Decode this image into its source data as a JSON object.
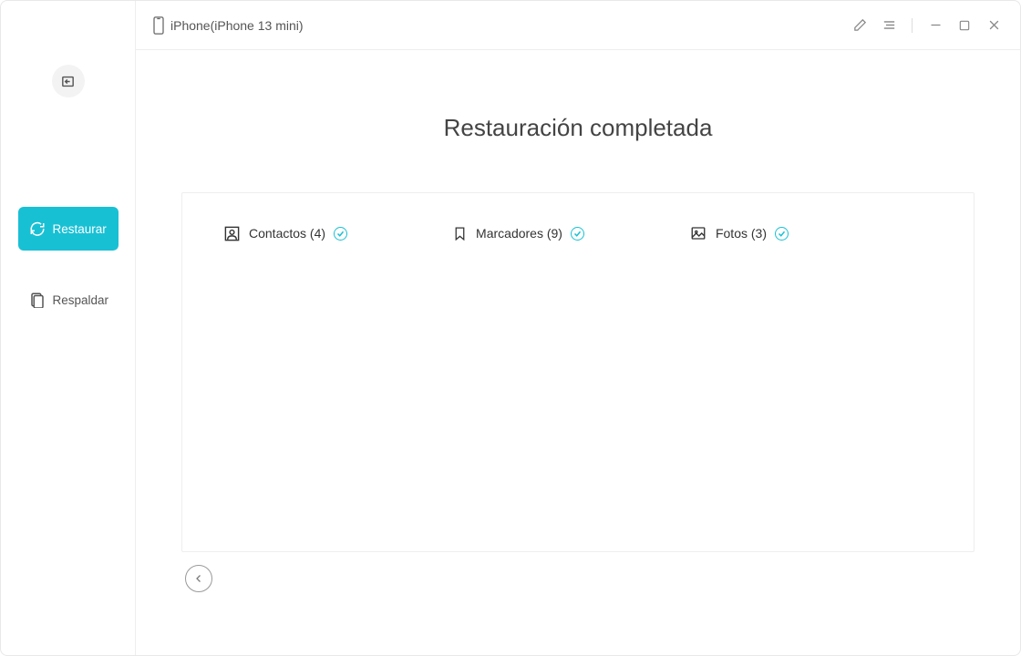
{
  "header": {
    "device_label": "iPhone(iPhone 13 mini)"
  },
  "sidebar": {
    "restore": "Restaurar",
    "backup": "Respaldar"
  },
  "title": "Restauración completada",
  "categories": [
    {
      "label": "Contactos (4)"
    },
    {
      "label": "Marcadores (9)"
    },
    {
      "label": "Fotos (3)"
    }
  ]
}
